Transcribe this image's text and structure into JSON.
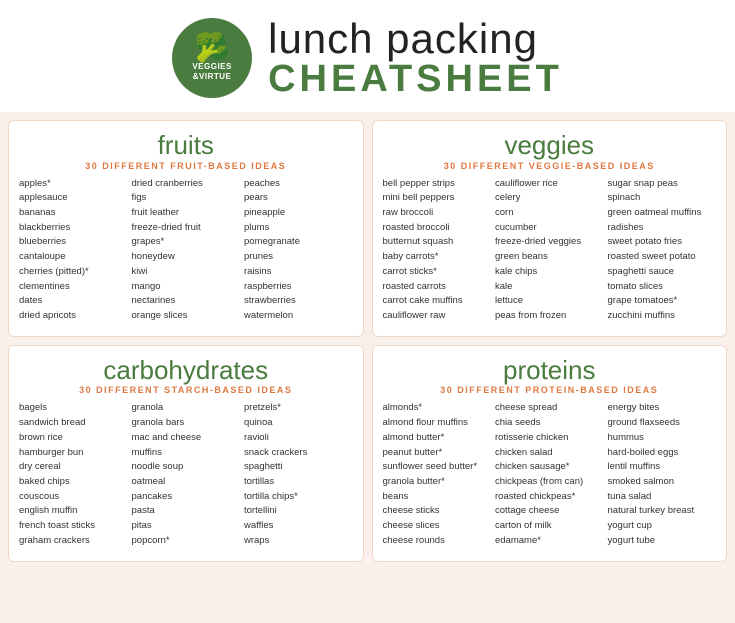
{
  "header": {
    "logo_line1": "VEGGIES",
    "logo_line2": "&VIRTUE",
    "lunch": "lunch packing",
    "cheatsheet": "CHEATSHEET"
  },
  "fruits": {
    "title": "fruits",
    "subtitle": "30 DIFFERENT FRUIT-BASED IDEAS",
    "col1": [
      "apples*",
      "applesauce",
      "bananas",
      "blackberries",
      "blueberries",
      "cantaloupe",
      "cherries (pitted)*",
      "clementines",
      "dates",
      "dried apricots"
    ],
    "col2": [
      "dried cranberries",
      "figs",
      "fruit leather",
      "freeze-dried fruit",
      "grapes*",
      "honeydew",
      "kiwi",
      "mango",
      "nectarines",
      "orange slices"
    ],
    "col3": [
      "peaches",
      "pears",
      "pineapple",
      "plums",
      "pomegranate",
      "prunes",
      "raisins",
      "raspberries",
      "strawberries",
      "watermelon"
    ]
  },
  "veggies": {
    "title": "veggies",
    "subtitle": "30 DIFFERENT VEGGIE-BASED IDEAS",
    "col1": [
      "bell pepper strips",
      "mini bell peppers",
      "raw broccoli",
      "roasted broccoli",
      "butternut squash",
      "baby carrots*",
      "carrot sticks*",
      "roasted carrots",
      "carrot cake muffins",
      "cauliflower raw"
    ],
    "col2": [
      "cauliflower rice",
      "celery",
      "corn",
      "cucumber",
      "freeze-dried veggies",
      "green beans",
      "kale chips",
      "kale",
      "lettuce",
      "peas from frozen"
    ],
    "col3": [
      "sugar snap peas",
      "spinach",
      "green oatmeal muffins",
      "radishes",
      "sweet potato fries",
      "roasted sweet potato",
      "spaghetti sauce",
      "tomato slices",
      "grape tomatoes*",
      "zucchini muffins"
    ]
  },
  "carbohydrates": {
    "title": "carbohydrates",
    "subtitle": "30 DIFFERENT STARCH-BASED IDEAS",
    "col1": [
      "bagels",
      "sandwich bread",
      "brown rice",
      "hamburger bun",
      "dry cereal",
      "baked chips",
      "couscous",
      "english muffin",
      "french toast sticks",
      "graham crackers"
    ],
    "col2": [
      "granola",
      "granola bars",
      "mac and cheese",
      "muffins",
      "noodle soup",
      "oatmeal",
      "pancakes",
      "pasta",
      "pitas",
      "popcorn*"
    ],
    "col3": [
      "pretzels*",
      "quinoa",
      "ravioli",
      "snack crackers",
      "spaghetti",
      "tortillas",
      "tortilla chips*",
      "tortellini",
      "waffles",
      "wraps"
    ]
  },
  "proteins": {
    "title": "proteins",
    "subtitle": "30 DIFFERENT PROTEIN-BASED IDEAS",
    "col1": [
      "almonds*",
      "almond flour muffins",
      "almond butter*",
      "peanut butter*",
      "sunflower seed butter*",
      "granola butter*",
      "beans",
      "cheese sticks",
      "cheese slices",
      "cheese rounds"
    ],
    "col2": [
      "cheese spread",
      "chia seeds",
      "rotisserie chicken",
      "chicken salad",
      "chicken sausage*",
      "chickpeas (from can)",
      "roasted chickpeas*",
      "cottage cheese",
      "carton of milk",
      "edamame*"
    ],
    "col3": [
      "energy bites",
      "ground flaxseeds",
      "hummus",
      "hard-boiled eggs",
      "lentil muffins",
      "smoked salmon",
      "tuna salad",
      "natural turkey breast",
      "yogurt cup",
      "yogurt tube"
    ]
  }
}
